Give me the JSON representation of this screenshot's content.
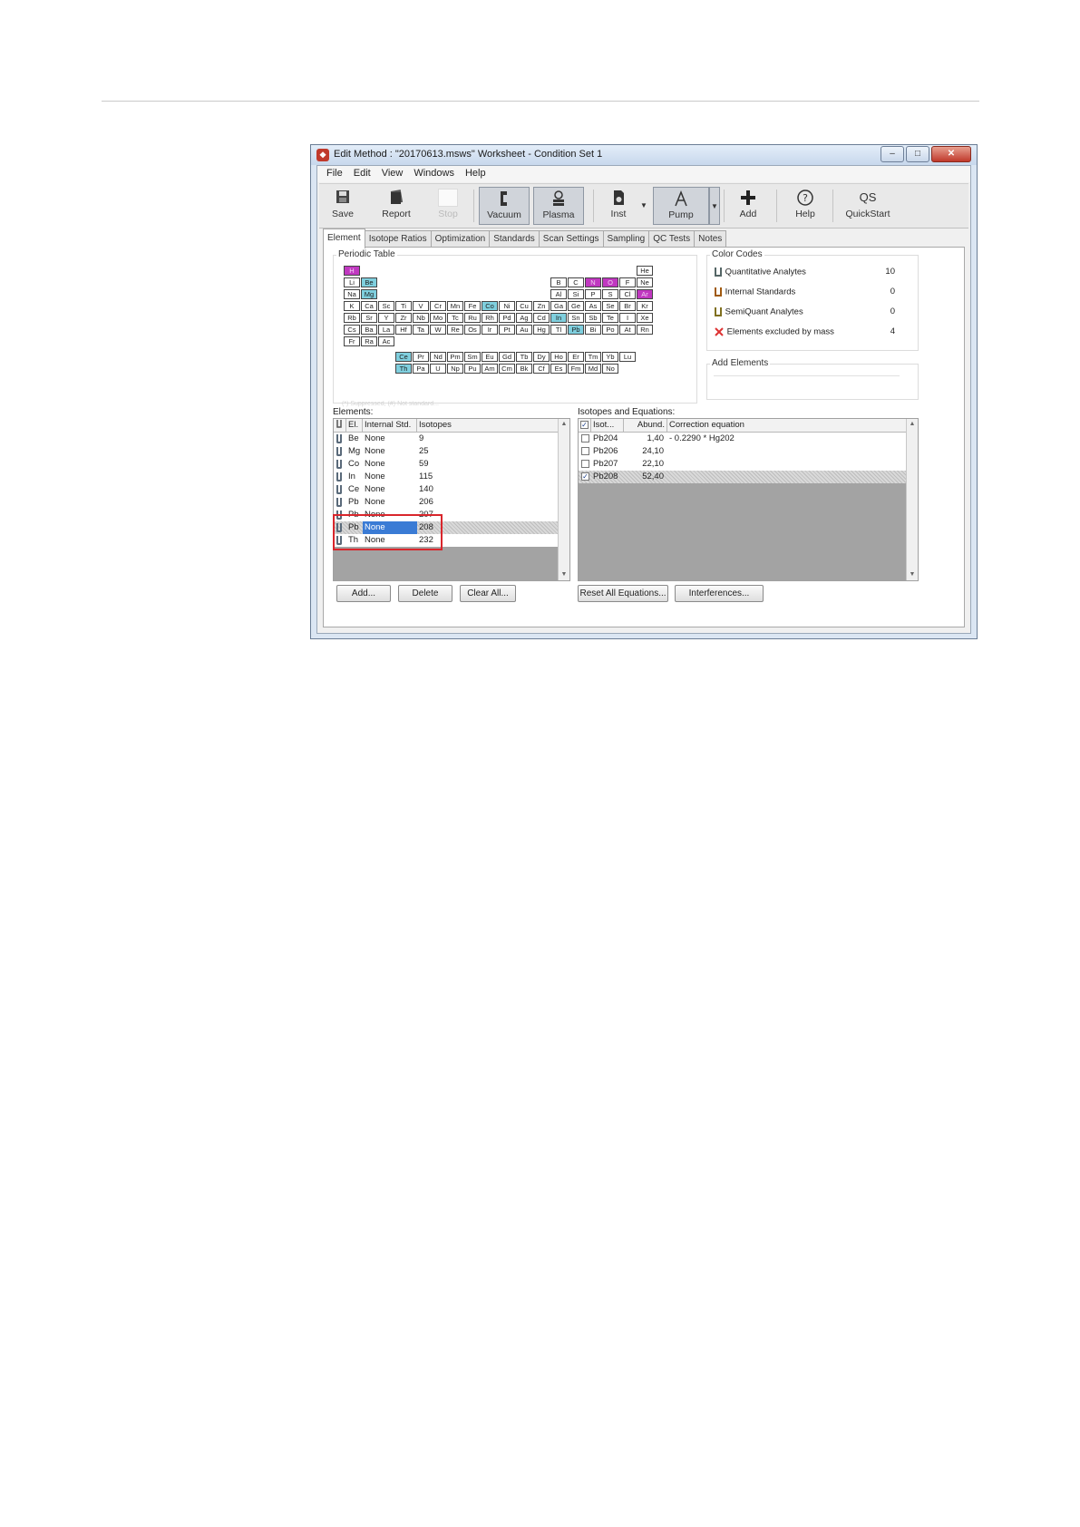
{
  "window": {
    "title": "Edit Method : \"20170613.msws\" Worksheet - Condition Set 1",
    "app_icon_glyph": "❖",
    "minimize_glyph": "–",
    "maximize_glyph": "□",
    "close_glyph": "✕"
  },
  "menu": [
    "File",
    "Edit",
    "View",
    "Windows",
    "Help"
  ],
  "toolbar": {
    "save": "Save",
    "report": "Report",
    "stop": "Stop",
    "vacuum": "Vacuum",
    "plasma": "Plasma",
    "inst": "Inst",
    "pump": "Pump",
    "add": "Add",
    "help": "Help",
    "quickstart": "QuickStart",
    "qs_icon": "QS",
    "dropdown_glyph": "▼"
  },
  "tabs": [
    "Element",
    "Isotope Ratios",
    "Optimization",
    "Standards",
    "Scan Settings",
    "Sampling",
    "QC Tests",
    "Notes"
  ],
  "periodic_table": {
    "title": "Periodic Table",
    "footnote": "(*) Suppressed, (#) Not standard..."
  },
  "color_codes": {
    "title": "Color Codes",
    "items": [
      {
        "label": "Quantitative Analytes",
        "count": "10"
      },
      {
        "label": "Internal Standards",
        "count": "0"
      },
      {
        "label": "SemiQuant Analytes",
        "count": "0"
      },
      {
        "label": "Elements excluded by mass",
        "count": "4"
      }
    ]
  },
  "add_elements": {
    "title": "Add Elements"
  },
  "elements": {
    "label": "Elements:",
    "headers": [
      "El.",
      "Internal Std.",
      "Isotopes"
    ],
    "rows": [
      {
        "el": "Be",
        "std": "None",
        "iso": "9"
      },
      {
        "el": "Mg",
        "std": "None",
        "iso": "25"
      },
      {
        "el": "Co",
        "std": "None",
        "iso": "59"
      },
      {
        "el": "In",
        "std": "None",
        "iso": "115"
      },
      {
        "el": "Ce",
        "std": "None",
        "iso": "140"
      },
      {
        "el": "Pb",
        "std": "None",
        "iso": "206"
      },
      {
        "el": "Pb",
        "std": "None",
        "iso": "207"
      },
      {
        "el": "Pb",
        "std": "None",
        "iso": "208"
      },
      {
        "el": "Th",
        "std": "None",
        "iso": "232"
      }
    ],
    "selected_index": 7
  },
  "isotopes": {
    "label": "Isotopes and Equations:",
    "headers": [
      "Isot...",
      "Abund.",
      "Correction equation"
    ],
    "rows": [
      {
        "iso": "Pb204",
        "abund": "1,40",
        "eq": "- 0.2290 * Hg202",
        "checked": false
      },
      {
        "iso": "Pb206",
        "abund": "24,10",
        "eq": "",
        "checked": false
      },
      {
        "iso": "Pb207",
        "abund": "22,10",
        "eq": "",
        "checked": false
      },
      {
        "iso": "Pb208",
        "abund": "52,40",
        "eq": "",
        "checked": true
      }
    ],
    "check_mark": "✓"
  },
  "buttons": {
    "add": "Add...",
    "delete": "Delete",
    "clear_all": "Clear All...",
    "reset_equations": "Reset All Equations...",
    "interferences": "Interferences..."
  },
  "colors": {
    "quantitative": "#7fcfde",
    "excluded": "#c038c0",
    "selection": "#3a7bd5",
    "highlight_box": "#d9262c"
  }
}
